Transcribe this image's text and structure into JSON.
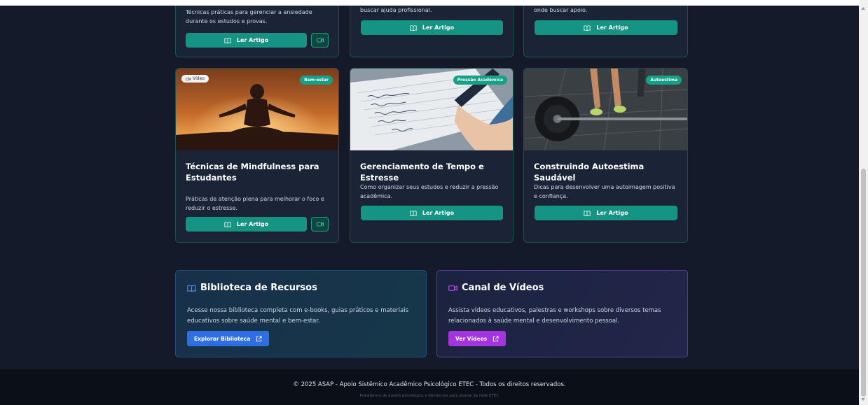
{
  "top_cards": [
    {
      "description": "Técnicas práticas para gerenciar a ansiedade durante os estudos e provas.",
      "read_label": "Ler Artigo",
      "has_video": true
    },
    {
      "description": "buscar ajuda profissional.",
      "read_label": "Ler Artigo",
      "has_video": false
    },
    {
      "description": "onde buscar apoio.",
      "read_label": "Ler Artigo",
      "has_video": false
    }
  ],
  "cards": [
    {
      "title": "Técnicas de Mindfulness para Estudantes",
      "description": "Práticas de atenção plena para melhorar o foco e reduzir o estresse.",
      "badge": "Bem-estar",
      "video_badge": "Vídeo",
      "read_label": "Ler Artigo",
      "has_video": true,
      "image": "meditation-image"
    },
    {
      "title": "Gerenciamento de Tempo e Estresse",
      "description": "Como organizar seus estudos e reduzir a pressão acadêmica.",
      "badge": "Pressão Acadêmica",
      "read_label": "Ler Artigo",
      "has_video": false,
      "image": "notebook-writing-image"
    },
    {
      "title": "Construindo Autoestima Saudável",
      "description": "Dicas para desenvolver uma autoimagem positiva e confiança.",
      "badge": "Autoestima",
      "read_label": "Ler Artigo",
      "has_video": false,
      "image": "weightlifting-image"
    }
  ],
  "library": {
    "title": "Biblioteca de Recursos",
    "description": "Acesse nossa biblioteca completa com e-books, guias práticos e materiais educativos sobre saúde mental e bem-estar.",
    "button": "Explorar Biblioteca",
    "accent": "#2f6fe4"
  },
  "videos": {
    "title": "Canal de Vídeos",
    "description": "Assista vídeos educativos, palestras e workshops sobre diversos temas relacionados à saúde mental e desenvolvimento pessoal.",
    "button": "Ver Vídeos",
    "accent": "#a434e0"
  },
  "footer": {
    "copyright": "© 2025 ASAP - Apoio Sistêmico Acadêmico Psicológico ETEC - Todos os direitos reservados.",
    "subtitle": "Plataforma de auxílio psicológico e denúncias para alunos da rede ETEC"
  },
  "colors": {
    "teal": "#169483",
    "background": "#141a2a",
    "card": "#1b2436"
  }
}
